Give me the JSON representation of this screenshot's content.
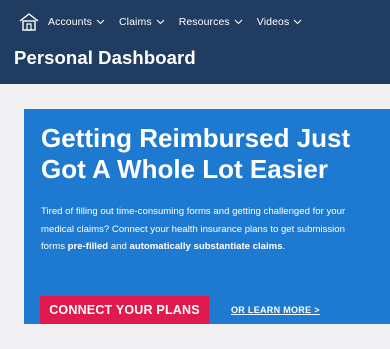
{
  "nav": {
    "home_icon": "home-icon",
    "items": [
      {
        "label": "Accounts"
      },
      {
        "label": "Claims"
      },
      {
        "label": "Resources"
      },
      {
        "label": "Videos"
      }
    ]
  },
  "header": {
    "title": "Personal Dashboard"
  },
  "hero": {
    "title": "Getting Reimbursed Just Got A Whole Lot Easier",
    "body_part1": "Tired of filling out time-consuming forms and getting challenged for your medical claims? Connect your health insurance plans to get submission forms ",
    "body_bold1": "pre-filled",
    "body_part2": " and ",
    "body_bold2": "automatically substantiate claims",
    "body_part3": ".",
    "cta_label": "CONNECT YOUR PLANS",
    "link_label": "OR LEARN MORE >"
  },
  "colors": {
    "topbar": "#213c61",
    "card": "#1e7ad0",
    "cta": "#e0194e",
    "page_bg": "#f1f1f3"
  }
}
